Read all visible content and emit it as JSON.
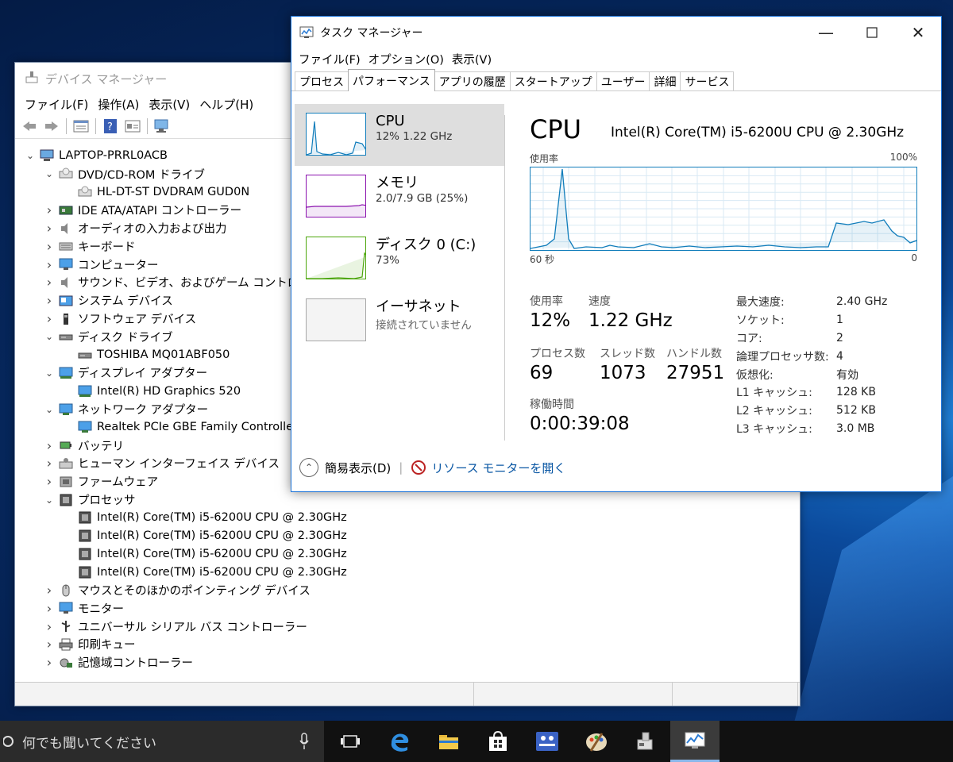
{
  "device_manager": {
    "title": "デバイス マネージャー",
    "menu": [
      "ファイル(F)",
      "操作(A)",
      "表示(V)",
      "ヘルプ(H)"
    ],
    "tree": [
      {
        "label": "LAPTOP-PRRL0ACB",
        "level": 0,
        "expander": "expanded",
        "icon": "computer-icon"
      },
      {
        "label": "DVD/CD-ROM ドライブ",
        "level": 1,
        "expander": "expanded",
        "icon": "dvd-drive-icon"
      },
      {
        "label": "HL-DT-ST DVDRAM GUD0N",
        "level": 2,
        "expander": "none",
        "icon": "dvd-drive-icon"
      },
      {
        "label": "IDE ATA/ATAPI コントローラー",
        "level": 1,
        "expander": "collapsed",
        "icon": "ide-controller-icon"
      },
      {
        "label": "オーディオの入力および出力",
        "level": 1,
        "expander": "collapsed",
        "icon": "speaker-icon"
      },
      {
        "label": "キーボード",
        "level": 1,
        "expander": "collapsed",
        "icon": "keyboard-icon"
      },
      {
        "label": "コンピューター",
        "level": 1,
        "expander": "collapsed",
        "icon": "monitor-icon"
      },
      {
        "label": "サウンド、ビデオ、およびゲーム コントローラー",
        "level": 1,
        "expander": "collapsed",
        "icon": "speaker-icon"
      },
      {
        "label": "システム デバイス",
        "level": 1,
        "expander": "collapsed",
        "icon": "system-device-icon"
      },
      {
        "label": "ソフトウェア デバイス",
        "level": 1,
        "expander": "collapsed",
        "icon": "software-device-icon"
      },
      {
        "label": "ディスク ドライブ",
        "level": 1,
        "expander": "expanded",
        "icon": "disk-drive-icon"
      },
      {
        "label": "TOSHIBA MQ01ABF050",
        "level": 2,
        "expander": "none",
        "icon": "disk-drive-icon"
      },
      {
        "label": "ディスプレイ アダプター",
        "level": 1,
        "expander": "expanded",
        "icon": "display-adapter-icon"
      },
      {
        "label": "Intel(R) HD Graphics 520",
        "level": 2,
        "expander": "none",
        "icon": "display-adapter-icon"
      },
      {
        "label": "ネットワーク アダプター",
        "level": 1,
        "expander": "expanded",
        "icon": "network-adapter-icon"
      },
      {
        "label": "Realtek PCIe GBE Family Controller",
        "level": 2,
        "expander": "none",
        "icon": "network-adapter-icon"
      },
      {
        "label": "バッテリ",
        "level": 1,
        "expander": "collapsed",
        "icon": "battery-icon"
      },
      {
        "label": "ヒューマン インターフェイス デバイス",
        "level": 1,
        "expander": "collapsed",
        "icon": "hid-icon"
      },
      {
        "label": "ファームウェア",
        "level": 1,
        "expander": "collapsed",
        "icon": "firmware-icon"
      },
      {
        "label": "プロセッサ",
        "level": 1,
        "expander": "expanded",
        "icon": "processor-icon"
      },
      {
        "label": "Intel(R) Core(TM) i5-6200U CPU @ 2.30GHz",
        "level": 2,
        "expander": "none",
        "icon": "processor-icon"
      },
      {
        "label": "Intel(R) Core(TM) i5-6200U CPU @ 2.30GHz",
        "level": 2,
        "expander": "none",
        "icon": "processor-icon"
      },
      {
        "label": "Intel(R) Core(TM) i5-6200U CPU @ 2.30GHz",
        "level": 2,
        "expander": "none",
        "icon": "processor-icon"
      },
      {
        "label": "Intel(R) Core(TM) i5-6200U CPU @ 2.30GHz",
        "level": 2,
        "expander": "none",
        "icon": "processor-icon"
      },
      {
        "label": "マウスとそのほかのポインティング デバイス",
        "level": 1,
        "expander": "collapsed",
        "icon": "mouse-icon"
      },
      {
        "label": "モニター",
        "level": 1,
        "expander": "collapsed",
        "icon": "monitor-icon"
      },
      {
        "label": "ユニバーサル シリアル バス コントローラー",
        "level": 1,
        "expander": "collapsed",
        "icon": "usb-icon"
      },
      {
        "label": "印刷キュー",
        "level": 1,
        "expander": "collapsed",
        "icon": "printer-icon"
      },
      {
        "label": "記憶域コントローラー",
        "level": 1,
        "expander": "collapsed",
        "icon": "storage-controller-icon"
      }
    ]
  },
  "task_manager": {
    "title": "タスク マネージャー",
    "menu": [
      "ファイル(F)",
      "オプション(O)",
      "表示(V)"
    ],
    "tabs": [
      "プロセス",
      "パフォーマンス",
      "アプリの履歴",
      "スタートアップ",
      "ユーザー",
      "詳細",
      "サービス"
    ],
    "active_tab": "パフォーマンス",
    "resources": [
      {
        "name": "CPU",
        "sub": "12%  1.22 GHz",
        "color": "#117dbb"
      },
      {
        "name": "メモリ",
        "sub": "2.0/7.9 GB (25%)",
        "color": "#8b12ae"
      },
      {
        "name": "ディスク 0 (C:)",
        "sub": "73%",
        "color": "#4da60c"
      },
      {
        "name": "イーサネット",
        "sub": "接続されていません",
        "color": "#a7a7a7"
      }
    ],
    "cpu": {
      "heading": "CPU",
      "model": "Intel(R) Core(TM) i5-6200U CPU @ 2.30GHz",
      "graph_label": "使用率",
      "graph_max": "100%",
      "graph_time": "60 秒",
      "graph_zero": "0",
      "utilization_label": "使用率",
      "utilization": "12%",
      "speed_label": "速度",
      "speed": "1.22 GHz",
      "processes_label": "プロセス数",
      "processes": "69",
      "threads_label": "スレッド数",
      "threads": "1073",
      "handles_label": "ハンドル数",
      "handles": "27951",
      "uptime_label": "稼働時間",
      "uptime": "0:00:39:08",
      "specs": [
        {
          "k": "最大速度:",
          "v": "2.40 GHz"
        },
        {
          "k": "ソケット:",
          "v": "1"
        },
        {
          "k": "コア:",
          "v": "2"
        },
        {
          "k": "論理プロセッサ数:",
          "v": "4"
        },
        {
          "k": "仮想化:",
          "v": "有効"
        },
        {
          "k": "L1 キャッシュ:",
          "v": "128 KB"
        },
        {
          "k": "L2 キャッシュ:",
          "v": "512 KB"
        },
        {
          "k": "L3 キャッシュ:",
          "v": "3.0 MB"
        }
      ]
    },
    "fewer_details": "簡易表示(D)",
    "resource_monitor": "リソース モニターを開く"
  },
  "taskbar": {
    "search_placeholder": "何でも聞いてください"
  }
}
